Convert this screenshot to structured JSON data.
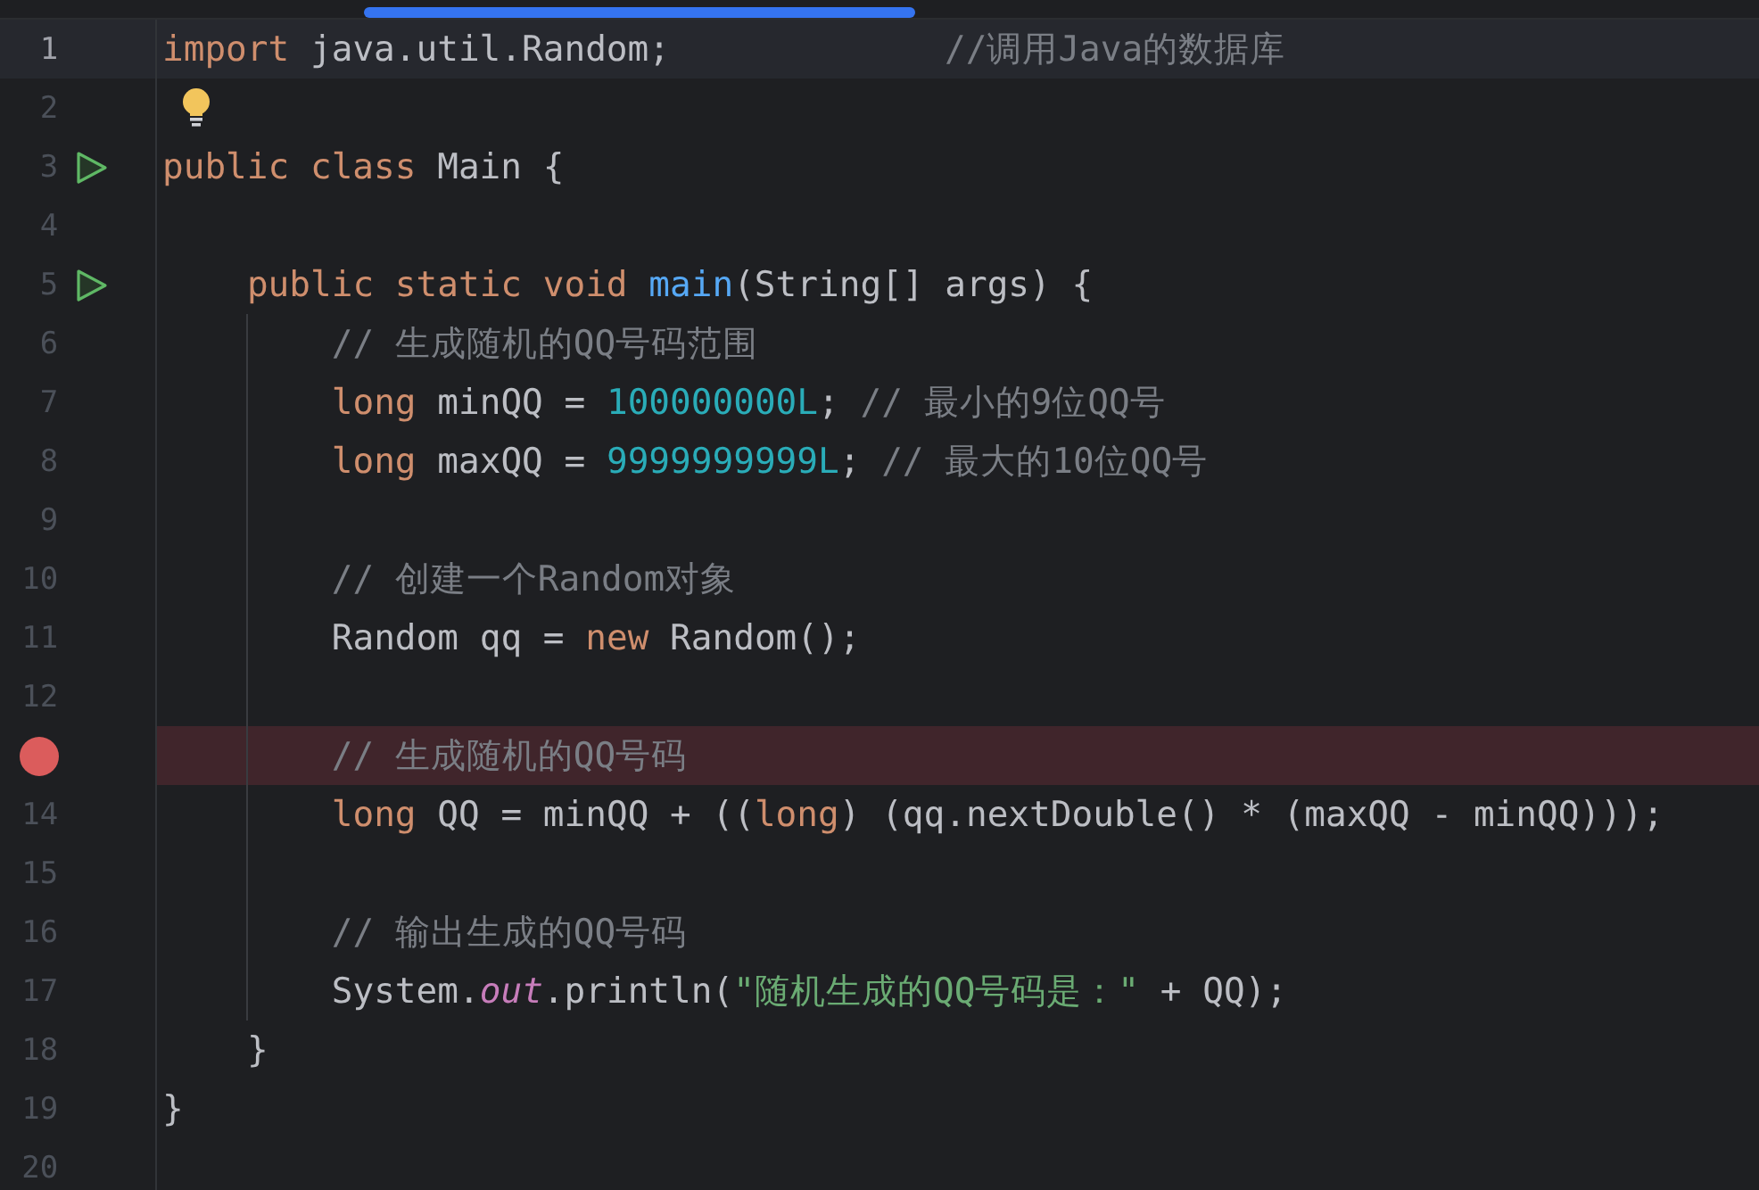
{
  "editor": {
    "lines": [
      {
        "number": "1",
        "current": true,
        "tokens": [
          {
            "kind": "keyword",
            "text": "import "
          },
          {
            "kind": "plain",
            "text": "java.util.Random;"
          },
          {
            "kind": "trailing-comment",
            "text": "//调用Java的数据库"
          }
        ]
      },
      {
        "number": "2",
        "current": false,
        "bulb": true
      },
      {
        "number": "3",
        "current": false,
        "run": true,
        "tokens": [
          {
            "kind": "keyword",
            "text": "public class "
          },
          {
            "kind": "plain",
            "text": "Main {"
          }
        ],
        "children": [
          {
            "number": "4",
            "current": false
          },
          {
            "number": "5",
            "current": false,
            "run": true,
            "tokens": [
              {
                "kind": "keyword",
                "text": "public static void "
              },
              {
                "kind": "method",
                "text": "main"
              },
              {
                "kind": "plain",
                "text": "(String[] args) {"
              }
            ],
            "children": [
              {
                "number": "6",
                "current": false,
                "tokens": [
                  {
                    "kind": "comment",
                    "text": "// 生成随机的QQ号码范围"
                  }
                ]
              },
              {
                "number": "7",
                "current": false,
                "tokens": [
                  {
                    "kind": "keyword",
                    "text": "long "
                  },
                  {
                    "kind": "plain",
                    "text": "minQQ = "
                  },
                  {
                    "kind": "number",
                    "text": "100000000L"
                  },
                  {
                    "kind": "plain",
                    "text": "; "
                  },
                  {
                    "kind": "comment",
                    "text": "// 最小的9位QQ号"
                  }
                ]
              },
              {
                "number": "8",
                "current": false,
                "tokens": [
                  {
                    "kind": "keyword",
                    "text": "long "
                  },
                  {
                    "kind": "plain",
                    "text": "maxQQ = "
                  },
                  {
                    "kind": "number",
                    "text": "9999999999L"
                  },
                  {
                    "kind": "plain",
                    "text": "; "
                  },
                  {
                    "kind": "comment",
                    "text": "// 最大的10位QQ号"
                  }
                ]
              },
              {
                "number": "9",
                "current": false
              },
              {
                "number": "10",
                "current": false,
                "tokens": [
                  {
                    "kind": "comment",
                    "text": "// 创建一个Random对象"
                  }
                ]
              },
              {
                "number": "11",
                "current": false,
                "tokens": [
                  {
                    "kind": "plain",
                    "text": "Random qq = "
                  },
                  {
                    "kind": "keyword",
                    "text": "new "
                  },
                  {
                    "kind": "plain",
                    "text": "Random();"
                  }
                ]
              },
              {
                "number": "12",
                "current": false
              },
              {
                "current": false,
                "breakpoint": true,
                "tokens": [
                  {
                    "kind": "comment",
                    "text": "// 生成随机的QQ号码"
                  }
                ]
              },
              {
                "number": "14",
                "current": false,
                "tokens": [
                  {
                    "kind": "keyword",
                    "text": "long "
                  },
                  {
                    "kind": "plain",
                    "text": "QQ = minQQ + (("
                  },
                  {
                    "kind": "keyword",
                    "text": "long"
                  },
                  {
                    "kind": "plain",
                    "text": ") (qq.nextDouble() * (maxQQ - minQQ)));"
                  }
                ]
              },
              {
                "number": "15",
                "current": false
              },
              {
                "number": "16",
                "current": false,
                "tokens": [
                  {
                    "kind": "comment",
                    "text": "// 输出生成的QQ号码"
                  }
                ]
              },
              {
                "number": "17",
                "current": false,
                "tokens": [
                  {
                    "kind": "plain",
                    "text": "System."
                  },
                  {
                    "kind": "field",
                    "text": "out"
                  },
                  {
                    "kind": "plain",
                    "text": ".println("
                  },
                  {
                    "kind": "string",
                    "text": "\"随机生成的QQ号码是：\""
                  },
                  {
                    "kind": "plain",
                    "text": " + QQ);"
                  }
                ]
              }
            ]
          },
          {
            "number": "18",
            "current": false,
            "tokens": [
              {
                "kind": "plain",
                "text": "}"
              }
            ]
          }
        ]
      },
      {
        "number": "19",
        "current": false,
        "tokens": [
          {
            "kind": "plain",
            "text": "}"
          }
        ]
      },
      {
        "number": "20",
        "current": false
      }
    ]
  }
}
